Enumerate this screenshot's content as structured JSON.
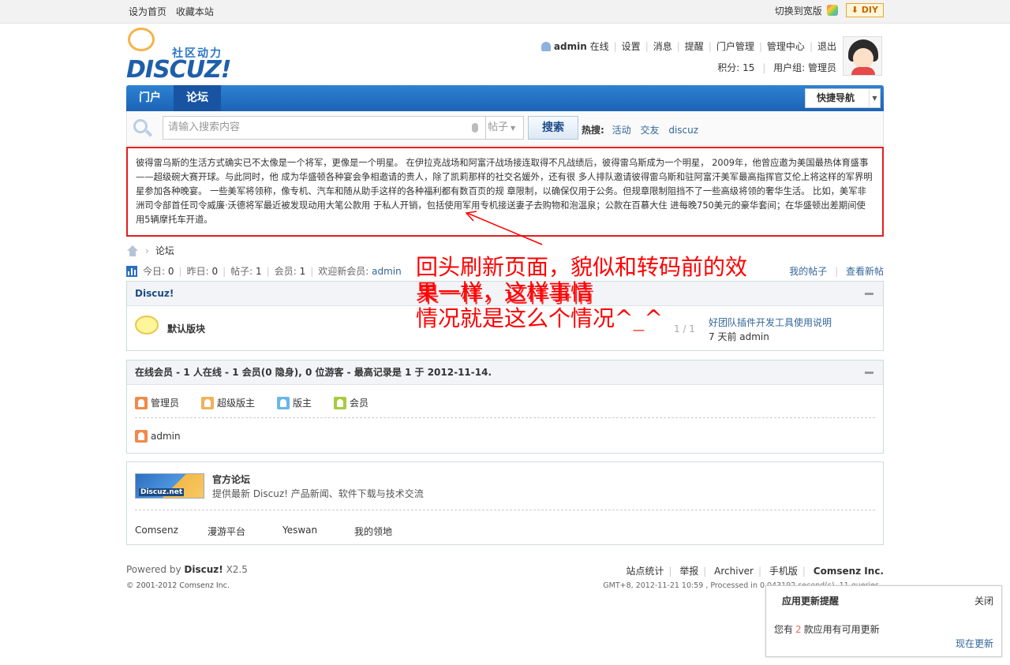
{
  "topbar": {
    "left_links": [
      "设为首页",
      "收藏本站"
    ],
    "wide_switch": "切换到宽版",
    "diy": "DIY"
  },
  "logo": {
    "cn": "社区动力",
    "en": "DISCUZ!"
  },
  "userbar": {
    "username": "admin",
    "status": "在线",
    "links": [
      "设置",
      "消息",
      "提醒",
      "门户管理",
      "管理中心",
      "退出"
    ],
    "credits_label": "积分: 15",
    "group_label": "用户组: 管理员"
  },
  "nav": {
    "items": [
      "门户",
      "论坛"
    ],
    "active": "论坛",
    "quicknav": "快捷导航"
  },
  "search": {
    "placeholder": "请输入搜索内容",
    "type": "帖子",
    "button": "搜索",
    "hot_label": "热搜:",
    "hot_words": [
      "活动",
      "交友",
      "discuz"
    ]
  },
  "quote_text": "彼得雷乌斯的生活方式确实已不太像是一个将军，更像是一个明星。 在伊拉克战场和阿富汗战场接连取得不凡战绩后，彼得雷乌斯成为一个明星， 2009年，他曾应邀为美国最热体育盛事——超级碗大赛开球。与此同时，他 成为华盛顿各种宴会争相邀请的贵人，除了凯莉那样的社交名媛外，还有很 多人排队邀请彼得雷乌斯和驻阿富汗美军最高指挥官艾伦上将这样的军界明 星参加各种晚宴。 一些美军将领称，像专机、汽车和随从助手这样的各种福利都有数百页的规 章限制，以确保仅用于公务。但规章限制阻挡不了一些高级将领的奢华生活。 比如，美军非洲司令部首任司令威廉·沃德将军最近被发现动用大笔公款用 于私人开销，包括使用军用专机接送妻子去购物和泡温泉；公款在百慕大住 进每晚750美元的豪华套间；在华盛顿出差期间使用5辆摩托车开道。",
  "breadcrumb": {
    "current": "论坛"
  },
  "stats": {
    "today_label": "今日:",
    "today": "0",
    "yesterday_label": "昨日:",
    "yesterday": "0",
    "posts_label": "帖子:",
    "posts": "1",
    "members_label": "会员:",
    "members": "1",
    "newest_label": "欢迎新会员:",
    "newest": "admin",
    "my_posts": "我的帖子",
    "new_posts": "查看新帖"
  },
  "category": {
    "title": "Discuz!",
    "forum_name": "默认版块",
    "forum_count": "1 / 1",
    "last_post_title": "好团队插件开发工具使用说明",
    "last_post_meta": "7 天前 admin"
  },
  "online": {
    "title": "在线会员 - 1 人在线 - 1 会员(0 隐身), 0 位游客 - 最高记录是 1 于 2012-11-14.",
    "groups": [
      {
        "label": "管理员",
        "color": "#f08a4b"
      },
      {
        "label": "超级版主",
        "color": "#f2b15a"
      },
      {
        "label": "版主",
        "color": "#6ab7e8"
      },
      {
        "label": "会员",
        "color": "#a6cc3d"
      }
    ],
    "users": [
      {
        "label": "admin",
        "color": "#f08a4b"
      }
    ]
  },
  "links_box": {
    "badge": "Discuz.net",
    "title": "官方论坛",
    "desc": "提供最新 Discuz! 产品新闻、软件下载与技术交流",
    "links": [
      "Comsenz",
      "漫游平台",
      "Yeswan",
      "我的领地"
    ]
  },
  "footer": {
    "powered_prefix": "Powered by",
    "powered_name": "Discuz!",
    "version": "X2.5",
    "copyright": "© 2001-2012 Comsenz Inc.",
    "links": [
      "站点统计",
      "举报",
      "Archiver",
      "手机版"
    ],
    "company": "Comsenz Inc.",
    "debug": "GMT+8, 2012-11-21 10:59 , Processed in 0.043192 second(s), 11 queries ."
  },
  "notice": {
    "title": "应用更新提醒",
    "close": "关闭",
    "body_prefix": "您有",
    "count": "2",
    "body_suffix": "款应用有可用更新",
    "action": "现在更新"
  },
  "annotations": {
    "line1": "回头刷新页面，貌似和转码前的效",
    "line2a": "果一样，这样事情",
    "line2b": "果一样，这样事情",
    "line3": "情况就是这么个情况^_^"
  },
  "colors": {
    "accent": "#1c63b7",
    "annotation": "#ff0000",
    "highlight_border": "#e21f1f"
  }
}
